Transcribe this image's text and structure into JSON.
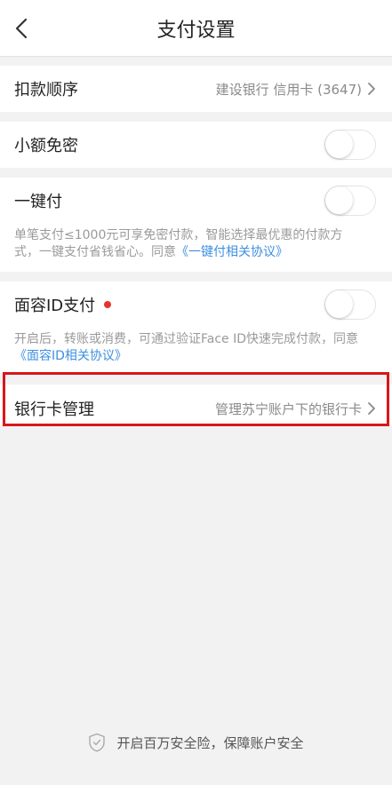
{
  "header": {
    "title": "支付设置"
  },
  "rows": {
    "deduction_order": {
      "label": "扣款顺序",
      "value": "建设银行  信用卡 (3647)"
    },
    "small_free": {
      "label": "小额免密",
      "toggle_on": false
    },
    "one_click": {
      "label": "一键付",
      "toggle_on": false,
      "desc_text": "单笔支付≤1000元可享免密付款，智能选择最优惠的付款方式，一键支付省钱省心。同意",
      "desc_link": "《一键付相关协议》"
    },
    "face_id": {
      "label": "面容ID支付",
      "toggle_on": false,
      "desc_text": "开启后，转账或消费，可通过验证Face ID快速完成付款，同意",
      "desc_link": "《面容ID相关协议》"
    },
    "bank_card": {
      "label": "银行卡管理",
      "value": "管理苏宁账户下的银行卡"
    }
  },
  "footer": {
    "text": "开启百万安全险，保障账户安全",
    "icon": "shield-check-icon"
  },
  "colors": {
    "link": "#3d8fe0",
    "highlight": "#d8161c",
    "badge": "#e8322e"
  }
}
